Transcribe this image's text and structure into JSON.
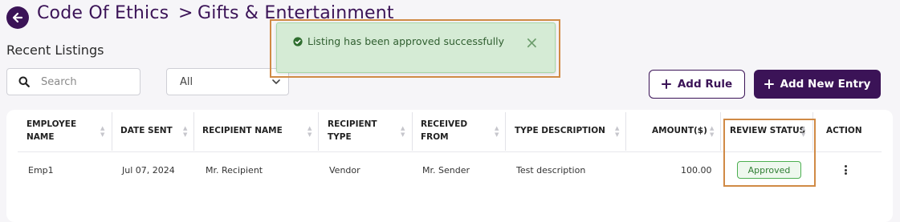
{
  "header": {
    "breadcrumb_parent": "Code Of Ethics",
    "breadcrumb_separator": ">",
    "breadcrumb_current": "Gifts & Entertainment"
  },
  "section_title": "Recent Listings",
  "search": {
    "placeholder": "Search",
    "value": ""
  },
  "filter": {
    "selected": "All"
  },
  "buttons": {
    "add_rule": "Add Rule",
    "add_new_entry": "Add New Entry"
  },
  "toast": {
    "message": "Listing has been approved successfully",
    "close": "×"
  },
  "table": {
    "columns": {
      "employee_name": [
        "EMPLOYEE",
        "NAME"
      ],
      "date_sent": "DATE SENT",
      "recipient_name": "RECIPIENT NAME",
      "recipient_type": [
        "RECIPIENT",
        "TYPE"
      ],
      "received_from": [
        "RECEIVED",
        "FROM"
      ],
      "type_description": "TYPE DESCRIPTION",
      "amount": "AMOUNT($)",
      "review_status": "REVIEW STATUS",
      "action": "ACTION"
    },
    "rows": [
      {
        "employee": "Emp1",
        "date_sent": "Jul 07, 2024",
        "recipient_name": "Mr. Recipient",
        "recipient_type": "Vendor",
        "received_from": "Mr. Sender",
        "type_description": "Test description",
        "amount": "100.00",
        "review_status": "Approved"
      }
    ]
  },
  "colors": {
    "brand": "#3b1357",
    "toast_bg": "#d5ebd5",
    "approved_green": "#2e7d32",
    "highlight": "#d08a45"
  },
  "icons": [
    "back-arrow-icon",
    "search-icon",
    "chevron-down-icon",
    "plus-icon",
    "check-circle-icon",
    "close-icon",
    "sort-icon",
    "kebab-menu-icon"
  ]
}
